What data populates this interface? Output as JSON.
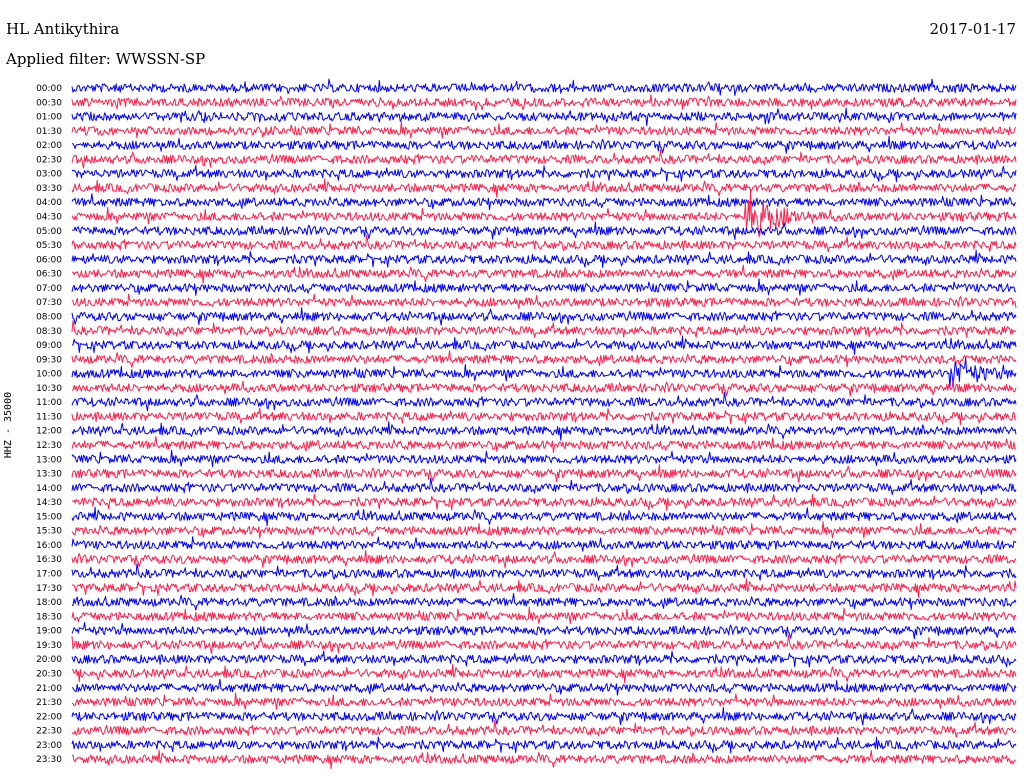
{
  "header": {
    "station": "HL Antikythira",
    "filter": "Applied filter: WWSSN-SP",
    "date": "2017-01-17"
  },
  "colors": {
    "trace_a": "#0000ff",
    "trace_b": "#ff1f4b",
    "background": "#ffffff",
    "text": "#000000"
  },
  "chart_data": {
    "type": "line",
    "title": "HL Antikythira",
    "subtitle": "Applied filter: WWSSN-SP",
    "ylabel": "HHZ - 35000",
    "xlabel": "",
    "grid": false,
    "legend": "none",
    "row_minutes": 30,
    "categories": [
      "00:00",
      "00:30",
      "01:00",
      "01:30",
      "02:00",
      "02:30",
      "03:00",
      "03:30",
      "04:00",
      "04:30",
      "05:00",
      "05:30",
      "06:00",
      "06:30",
      "07:00",
      "07:30",
      "08:00",
      "08:30",
      "09:00",
      "09:30",
      "10:00",
      "10:30",
      "11:00",
      "11:30",
      "12:00",
      "12:30",
      "13:00",
      "13:30",
      "14:00",
      "14:30",
      "15:00",
      "15:30",
      "16:00",
      "16:30",
      "17:00",
      "17:30",
      "18:00",
      "18:30",
      "19:00",
      "19:30",
      "20:00",
      "20:30",
      "21:00",
      "21:30",
      "22:00",
      "22:30",
      "23:00",
      "23:30"
    ],
    "series": [
      {
        "color": "#0000ff",
        "rows": [
          "00:00",
          "01:00",
          "02:00",
          "03:00",
          "04:00",
          "05:00",
          "06:00",
          "07:00",
          "08:00",
          "09:00",
          "10:00",
          "11:00",
          "12:00",
          "13:00",
          "14:00",
          "15:00",
          "16:00",
          "17:00",
          "18:00",
          "19:00",
          "20:00",
          "21:00",
          "22:00",
          "23:00"
        ]
      },
      {
        "color": "#ff1f4b",
        "rows": [
          "00:30",
          "01:30",
          "02:30",
          "03:30",
          "04:30",
          "05:30",
          "06:30",
          "07:30",
          "08:30",
          "09:30",
          "10:30",
          "11:30",
          "12:30",
          "13:30",
          "14:30",
          "15:30",
          "16:30",
          "17:30",
          "18:30",
          "19:30",
          "20:30",
          "21:30",
          "22:30",
          "23:30"
        ]
      }
    ],
    "events": [
      {
        "row": "04:30",
        "minute": 21.5,
        "amplitude": "large"
      },
      {
        "row": "10:00",
        "minute": 28.0,
        "amplitude": "medium"
      }
    ]
  }
}
